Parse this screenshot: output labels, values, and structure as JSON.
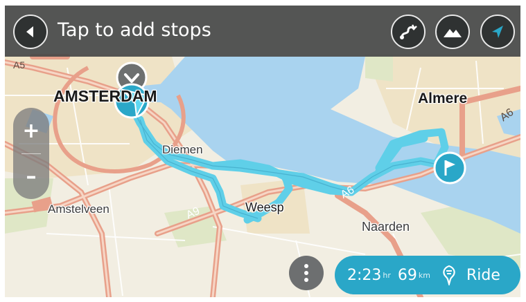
{
  "header": {
    "back_icon": "back-arrow-icon",
    "title": "Tap to add stops",
    "buttons": [
      {
        "name": "route-icon",
        "semantic": "route-options"
      },
      {
        "name": "mountain-icon",
        "semantic": "thrilling-route"
      },
      {
        "name": "navigation-arrow-icon",
        "semantic": "current-location"
      }
    ]
  },
  "map": {
    "cities": {
      "amsterdam": "AMSTERDAM",
      "almere": "Almere",
      "diemen": "Diemen",
      "amstelveen": "Amstelveen",
      "weesp": "Weesp",
      "naarden": "Naarden"
    },
    "roads": {
      "a5": "A5",
      "a6_left": "A6",
      "a6_right": "A6",
      "a9": "A9"
    },
    "colors": {
      "route": "#5fcfe8",
      "water": "#a9d3ef",
      "land": "#f2eee2",
      "major_road": "#e8a08a"
    }
  },
  "zoom": {
    "in_label": "+",
    "out_label": "–"
  },
  "summary": {
    "more_icon": "more-options-icon",
    "time": "2:23",
    "time_unit": "hr",
    "distance": "69",
    "distance_unit": "km",
    "ride_icon": "motorcycle-icon",
    "ride_label": "Ride",
    "accent": "#2aa7c8"
  }
}
